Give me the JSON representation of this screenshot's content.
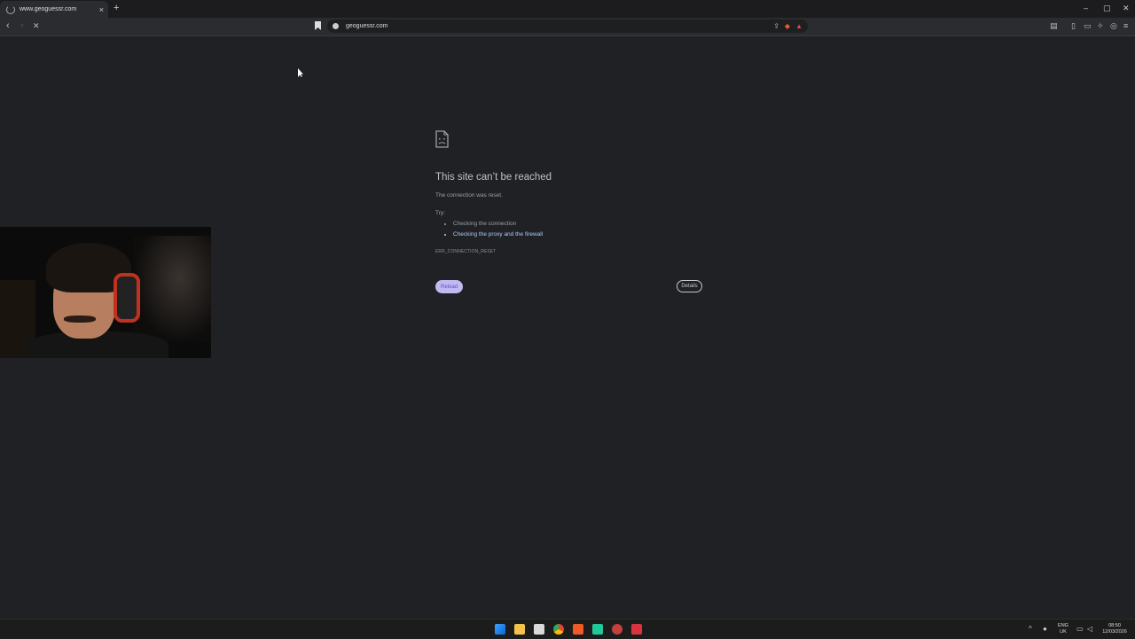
{
  "browser": {
    "tab_title": "www.geoguessr.com",
    "url": "geoguessr.com",
    "new_tab_symbol": "+",
    "close_tab_symbol": "×",
    "window_controls": [
      "–",
      "▢",
      "✕"
    ]
  },
  "error_page": {
    "title": "This site can’t be reached",
    "message": "The connection was reset.",
    "try_label": "Try:",
    "suggestions": [
      {
        "text": "Checking the connection",
        "is_link": false
      },
      {
        "text": "Checking the proxy and the firewall",
        "is_link": true
      }
    ],
    "error_code": "ERR_CONNECTION_RESET",
    "reload_label": "Reload",
    "details_label": "Details"
  },
  "taskbar": {
    "apps": [
      "windows-start",
      "file-explorer",
      "microsoft-store",
      "chrome",
      "brave",
      "app-green",
      "app-red",
      "app-red-badge"
    ],
    "language": "ENG",
    "region": "UK",
    "time": "08:50",
    "date": "12/03/2026"
  },
  "colors": {
    "page_bg": "#202124",
    "reload_bg": "#c2b9f0",
    "link": "#aecbfa"
  }
}
